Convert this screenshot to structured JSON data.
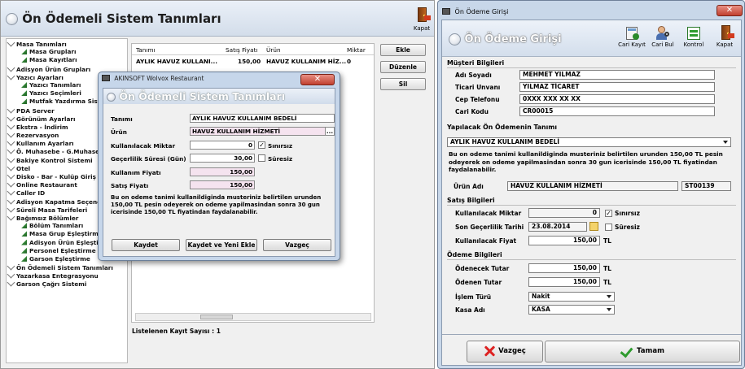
{
  "left_window": {
    "title": "Ön Ödemeli Sistem Tanımları",
    "close_label": "Kapat",
    "tree": [
      {
        "label": "Masa Tanımları",
        "level": 1
      },
      {
        "label": "Masa Grupları",
        "level": 2
      },
      {
        "label": "Masa Kayıtları",
        "level": 2
      },
      {
        "label": "Adisyon Ürün Grupları",
        "level": 1
      },
      {
        "label": "Yazıcı Ayarları",
        "level": 1
      },
      {
        "label": "Yazıcı Tanımları",
        "level": 2
      },
      {
        "label": "Yazıcı Seçimleri",
        "level": 2
      },
      {
        "label": "Mutfak Yazdırma Sistemi",
        "level": 2
      },
      {
        "label": "PDA Server",
        "level": 1
      },
      {
        "label": "Görünüm Ayarları",
        "level": 1
      },
      {
        "label": "Ekstra - İndirim",
        "level": 1
      },
      {
        "label": "Rezervasyon",
        "level": 1
      },
      {
        "label": "Kullanım Ayarları",
        "level": 1
      },
      {
        "label": "Ö. Muhasebe - G.Muhasebe",
        "level": 1
      },
      {
        "label": "Bakiye Kontrol Sistemi",
        "level": 1
      },
      {
        "label": "Otel",
        "level": 1
      },
      {
        "label": "Disko - Bar - Kulüp Giriş",
        "level": 1
      },
      {
        "label": "Online Restaurant",
        "level": 1
      },
      {
        "label": "Caller ID",
        "level": 1
      },
      {
        "label": "Adisyon Kapatma Seçenekleri",
        "level": 1
      },
      {
        "label": "Süreli Masa Tarifeleri",
        "level": 1
      },
      {
        "label": "Bağımsız Bölümler",
        "level": 1
      },
      {
        "label": "Bölüm Tanımları",
        "level": 2
      },
      {
        "label": "Masa Grup Eşleştirme",
        "level": 2
      },
      {
        "label": "Adisyon Ürün Eşleştirme",
        "level": 2
      },
      {
        "label": "Personel Eşleştirme",
        "level": 2
      },
      {
        "label": "Garson Eşleştirme",
        "level": 2
      },
      {
        "label": "Ön Ödemeli Sistem Tanımları",
        "level": 1
      },
      {
        "label": "Yazarkasa Entegrasyonu",
        "level": 1
      },
      {
        "label": "Garson Çağrı Sistemi",
        "level": 1
      }
    ],
    "grid": {
      "columns": [
        "Tanımı",
        "Satış Fiyatı",
        "Ürün",
        "Miktar"
      ],
      "row": [
        "AYLIK HAVUZ KULLANI...",
        "150,00",
        "HAVUZ KULLANIM HİZ...",
        "0"
      ]
    },
    "buttons": {
      "add": "Ekle",
      "edit": "Düzenle",
      "delete": "Sil"
    },
    "row_count_label": "Listelenen Kayıt Sayısı : 1"
  },
  "dialog": {
    "window_title": "AKINSOFT Wolvox Restaurant",
    "title": "Ön Ödemeli Sistem Tanımları",
    "labels": {
      "name": "Tanımı",
      "product": "Ürün",
      "quantity": "Kullanılacak Miktar",
      "validity": "Geçerlilik Süresi (Gün)",
      "usage_price": "Kullanım Fiyatı",
      "sale_price": "Satış Fiyatı",
      "unlimited": "Sınırsız",
      "indefinite": "Süresiz"
    },
    "values": {
      "name": "AYLIK HAVUZ KULLANIM BEDELİ",
      "product": "HAVUZ KULLANIM HİZMETİ",
      "quantity": "0",
      "validity": "30,00",
      "usage_price": "150,00",
      "sale_price": "150,00",
      "unlimited_checked": "✓",
      "product_browse": "..."
    },
    "description": "Bu on odeme tanimi kullanildiginda musteriniz belirtilen urunden 150,00 TL pesin odeyerek on odeme yapilmasindan sonra 30 gun icerisinde 150,00 TL fiyatindan faydalanabilir.",
    "buttons": {
      "save": "Kaydet",
      "save_new": "Kaydet ve Yeni Ekle",
      "cancel": "Vazgeç"
    }
  },
  "right_window": {
    "window_title": "Ön Ödeme Girişi",
    "title": "Ön Ödeme Girişi",
    "toolbar": [
      {
        "label": "Cari Kayıt",
        "icon": "calculator-icon"
      },
      {
        "label": "Cari Bul",
        "icon": "user-search-icon"
      },
      {
        "label": "Kontrol",
        "icon": "control-icon"
      },
      {
        "label": "Kapat",
        "icon": "door-exit-icon"
      }
    ],
    "customer": {
      "section": "Müşteri Bilgileri",
      "labels": {
        "name": "Adı Soyadı",
        "company": "Ticari Unvanı",
        "phone": "Cep Telefonu",
        "code": "Cari Kodu"
      },
      "values": {
        "name": "MEHMET YILMAZ",
        "company": "YILMAZ TİCARET",
        "phone": "0XXX XXX XX XX",
        "code": "CR00015"
      }
    },
    "definition": {
      "section": "Yapılacak Ön Ödemenin Tanımı",
      "selected": "AYLIK HAVUZ KULLANIM BEDELİ",
      "description": "Bu on odeme tanimi kullanildiginda musteriniz belirtilen urunden 150,00 TL pesin odeyerek on odeme yapilmasindan sonra 30 gun icerisinde  150,00 TL fiyatindan faydalanabilir.",
      "product_label": "Ürün Adı",
      "product_value": "HAVUZ KULLANIM HİZMETİ",
      "product_code": "ST00139"
    },
    "sale": {
      "section": "Satış Bilgileri",
      "labels": {
        "quantity": "Kullanılacak Miktar",
        "last_date": "Son Geçerlilik Tarihi",
        "price": "Kullanılacak Fiyat",
        "unlimited": "Sınırsız",
        "indefinite": "Süresiz",
        "currency": "TL"
      },
      "values": {
        "quantity": "0",
        "last_date": "23.08.2014",
        "price": "150,00",
        "unlimited_checked": "✓"
      }
    },
    "payment": {
      "section": "Ödeme Bilgileri",
      "labels": {
        "to_pay": "Ödenecek Tutar",
        "paid": "Ödenen Tutar",
        "type": "İşlem Türü",
        "cash": "Kasa Adı",
        "currency": "TL"
      },
      "values": {
        "to_pay": "150,00",
        "paid": "150,00",
        "type": "Nakit",
        "cash": "KASA"
      }
    },
    "buttons": {
      "cancel": "Vazgeç",
      "ok": "Tamam"
    }
  }
}
